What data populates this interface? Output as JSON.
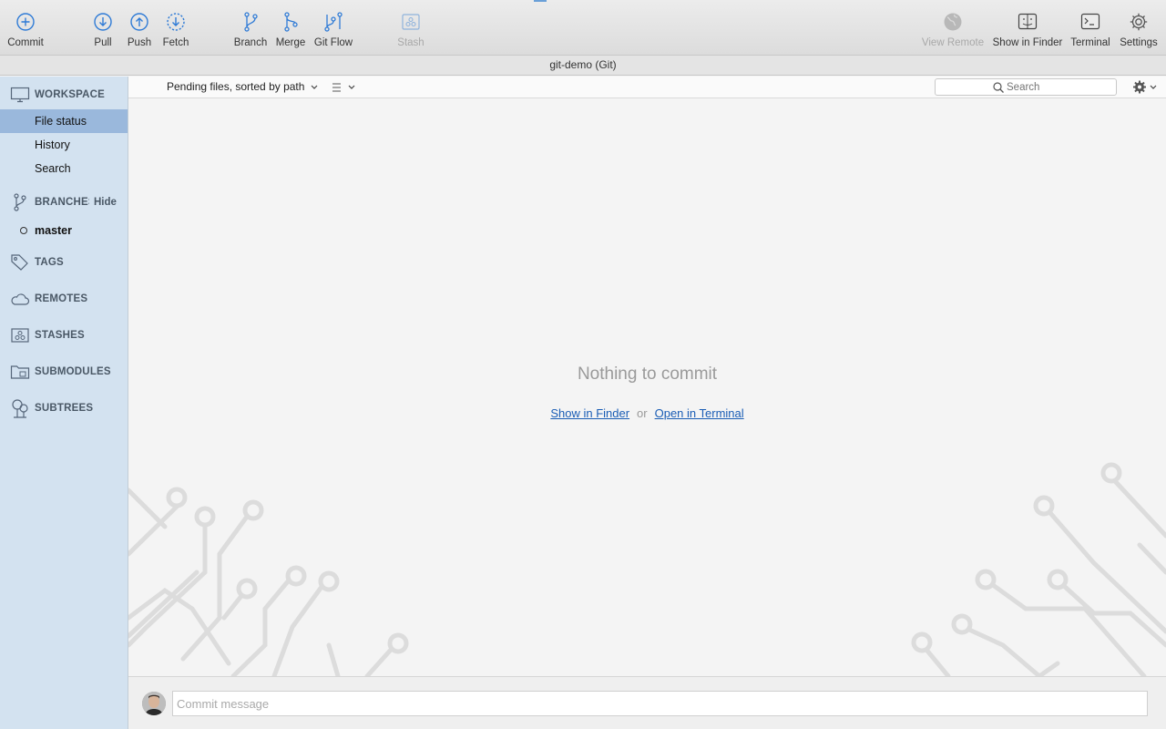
{
  "toolbar": {
    "commit": "Commit",
    "pull": "Pull",
    "push": "Push",
    "fetch": "Fetch",
    "branch": "Branch",
    "merge": "Merge",
    "git_flow": "Git Flow",
    "stash": "Stash",
    "view_remote": "View Remote",
    "show_in_finder": "Show in Finder",
    "terminal": "Terminal",
    "settings": "Settings"
  },
  "window": {
    "title": "git-demo (Git)"
  },
  "sidebar": {
    "workspace": "WORKSPACE",
    "items": [
      "File status",
      "History",
      "Search"
    ],
    "branches": "BRANCHES",
    "hide": "Hide",
    "branch_current": "master",
    "tags": "TAGS",
    "remotes": "REMOTES",
    "stashes": "STASHES",
    "submodules": "SUBMODULES",
    "subtrees": "SUBTREES"
  },
  "filter": {
    "label": "Pending files, sorted by path",
    "search_placeholder": "Search"
  },
  "main": {
    "empty_title": "Nothing to commit",
    "link_finder": "Show in Finder",
    "or": "or",
    "link_terminal": "Open in Terminal"
  },
  "commit": {
    "placeholder": "Commit message"
  },
  "colors": {
    "accent": "#1a6fd0",
    "sidebar_bg": "#d3e2f0",
    "selected": "#9ab8dc"
  }
}
